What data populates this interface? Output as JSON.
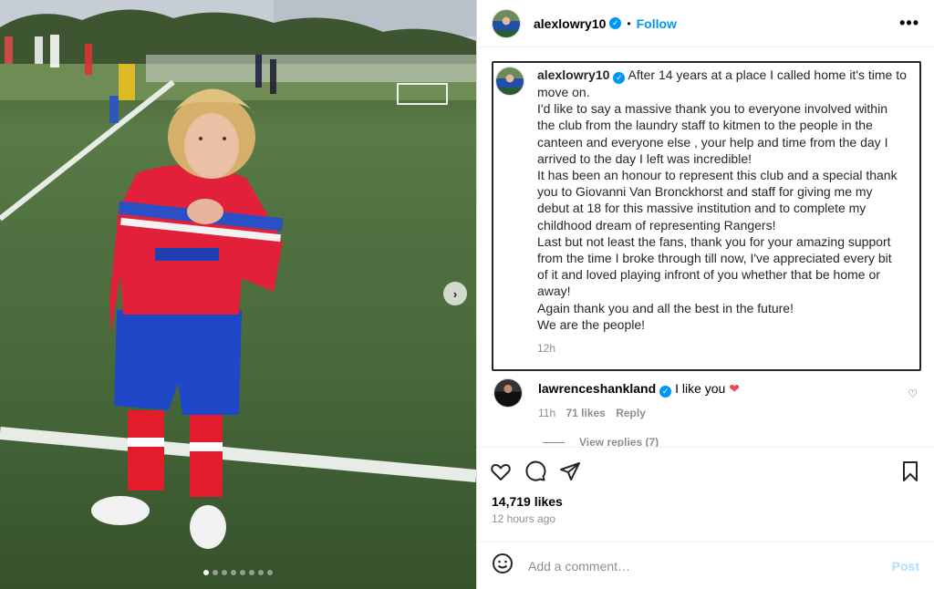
{
  "post": {
    "username": "alexlowry10",
    "follow_label": "Follow",
    "separator": "•",
    "more_label": "•••",
    "verified_mark": "✓"
  },
  "media": {
    "description_icon": "photo",
    "next_arrow": "›",
    "slide_count": 8,
    "active_slide": 1
  },
  "caption": {
    "username": "alexlowry10",
    "lines": [
      "After 14 years at a place I called home it's time to",
      "move on.",
      "I'd like to say a massive thank you to everyone involved within",
      "the club from the laundry staff to kitmen to the people in the",
      "canteen and everyone else , your help and time from the day I",
      "arrived to the day I left was incredible!",
      "It has been an honour to represent this club and a special thank",
      "you to Giovanni Van Bronckhorst and staff for giving me my",
      "debut at 18 for this massive institution and to complete my",
      "childhood dream of representing Rangers!",
      "Last but not least the fans, thank you for your amazing support",
      "from the time I broke through till now, I've appreciated every bit",
      "of it and loved playing infront of you whether that be home or",
      "away!",
      "Again thank you and all the best in the future!",
      "We are the people!"
    ],
    "time": "12h"
  },
  "comment": {
    "username": "lawrenceshankland",
    "text": "I like you",
    "emoji": "❤",
    "time": "11h",
    "likes": "71 likes",
    "reply_label": "Reply",
    "like_icon": "♡",
    "view_replies": "View replies (7)"
  },
  "actions": {
    "icons": [
      "heart-icon",
      "comment-icon",
      "share-icon",
      "bookmark-icon"
    ]
  },
  "stats": {
    "likes": "14,719 likes",
    "posted": "12 hours ago"
  },
  "add_comment": {
    "emoji_icon": "emoji-icon",
    "placeholder": "Add a comment…",
    "post_label": "Post"
  },
  "colors": {
    "accent": "#0095f6",
    "heart": "#ed4956",
    "post_disabled": "#b2dffc"
  }
}
